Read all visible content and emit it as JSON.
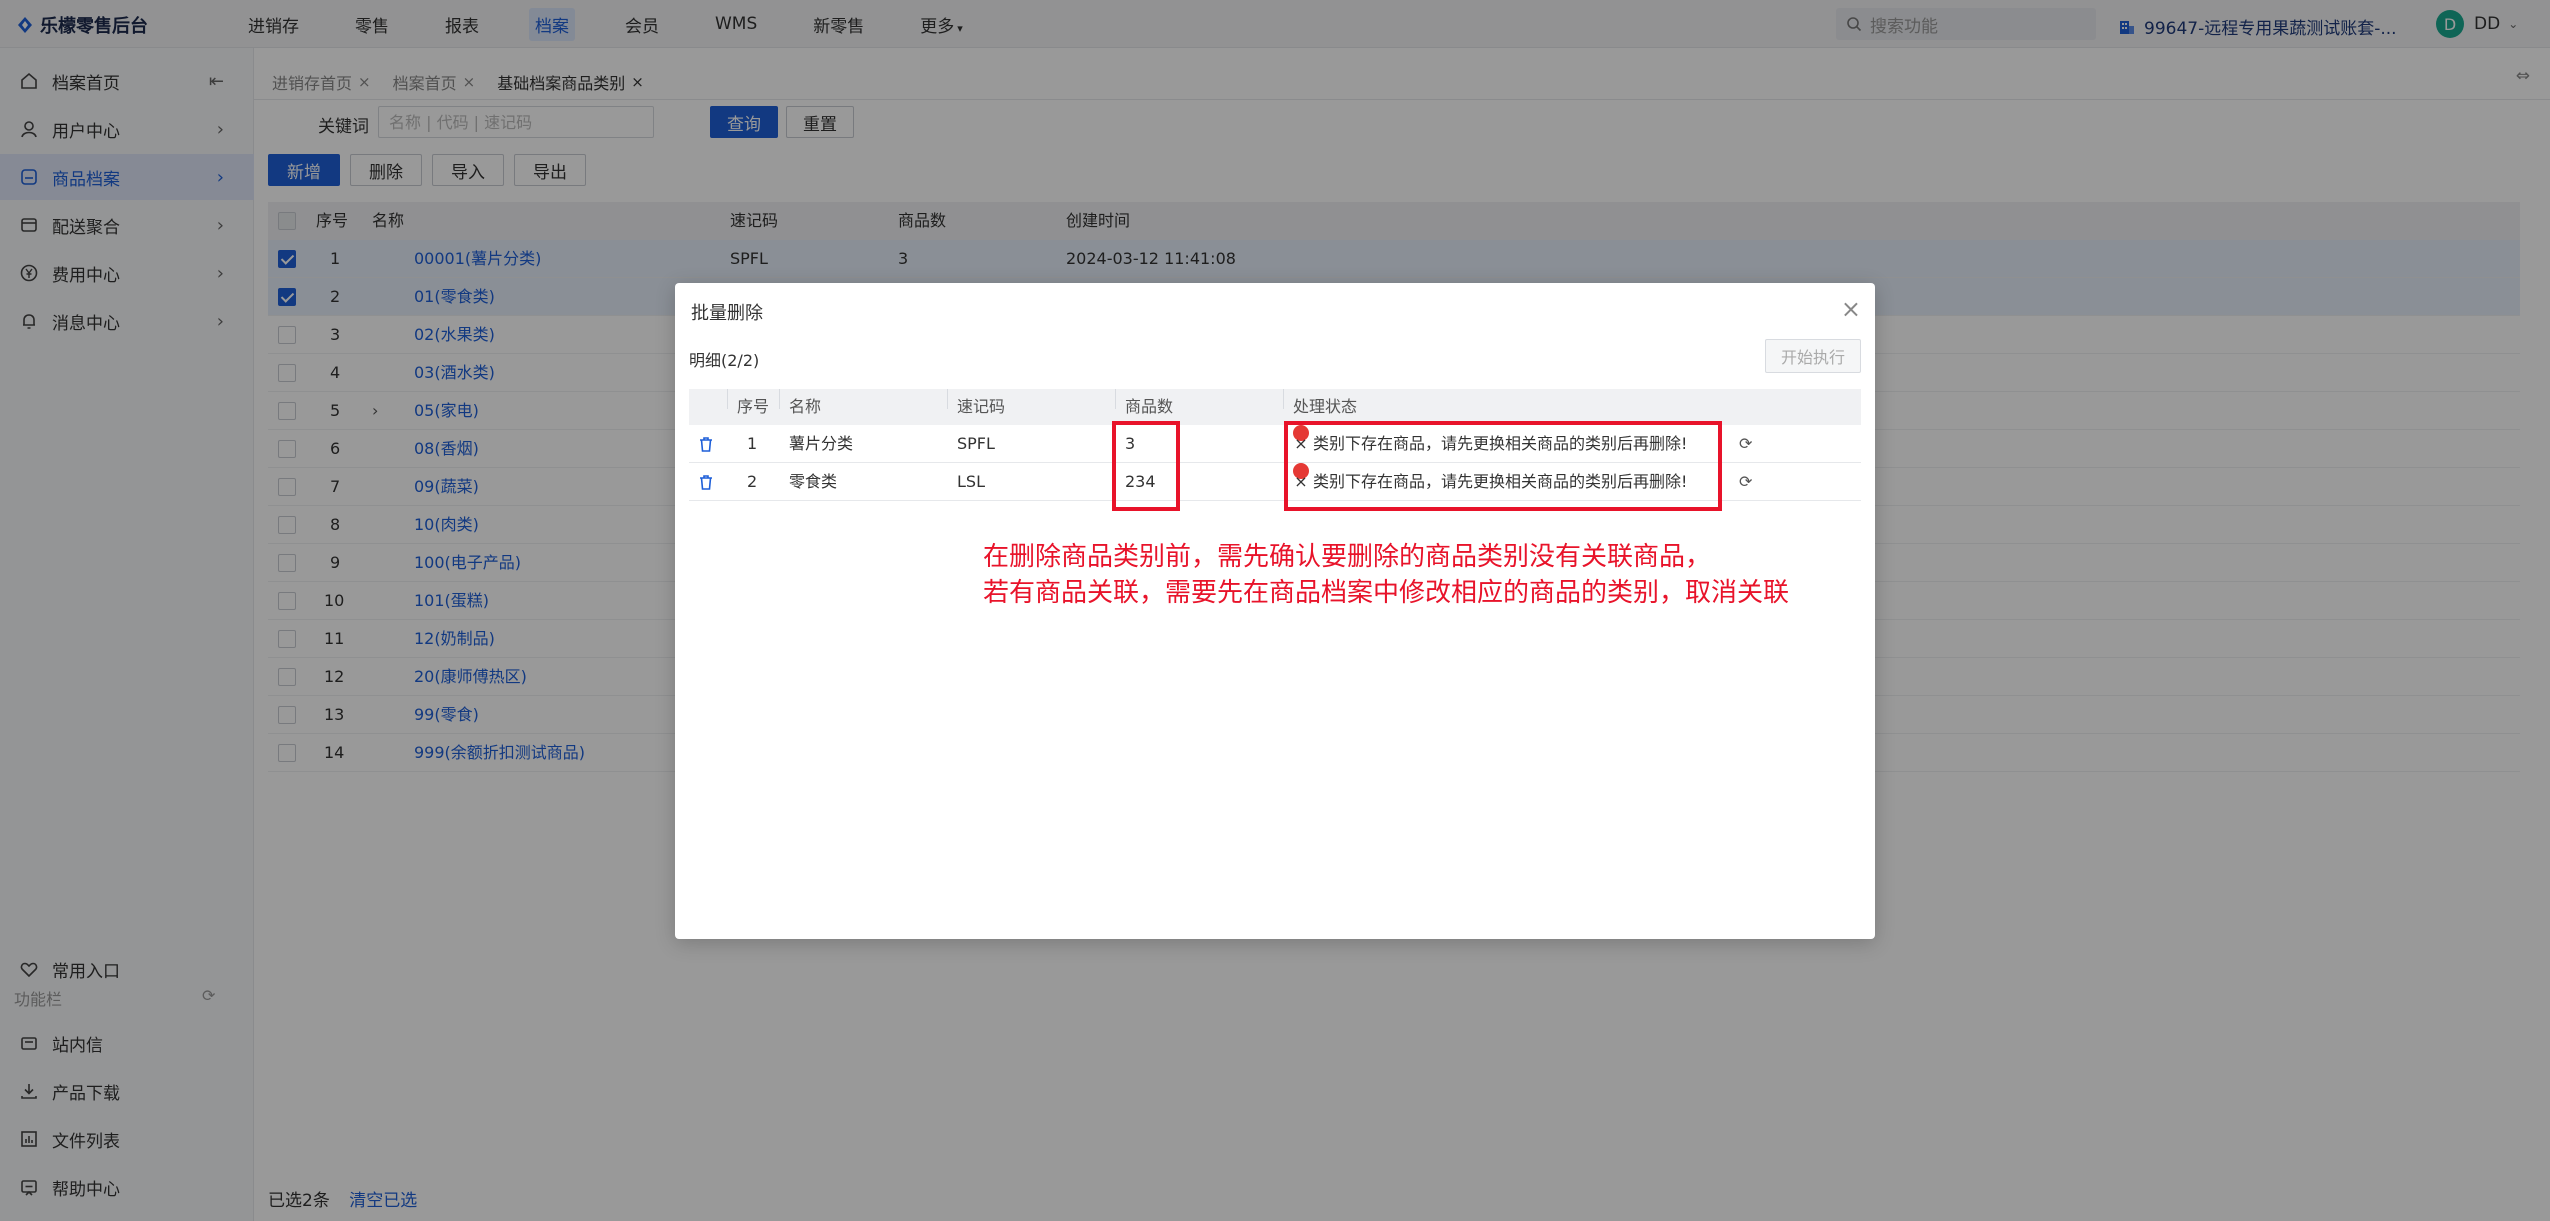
{
  "app": {
    "name": "乐檬零售后台"
  },
  "topnav": [
    "进销存",
    "零售",
    "报表",
    "档案",
    "会员",
    "WMS",
    "新零售",
    "更多"
  ],
  "topnav_active": "档案",
  "search": {
    "placeholder": "搜索功能"
  },
  "account": {
    "label": "99647-远程专用果蔬测试账套-..."
  },
  "user": {
    "initial": "D",
    "name": "DD"
  },
  "sidebar": {
    "items": [
      {
        "label": "档案首页",
        "icon": "home-icon"
      },
      {
        "label": "用户中心",
        "icon": "user-icon"
      },
      {
        "label": "商品档案",
        "icon": "box-icon"
      },
      {
        "label": "配送聚合",
        "icon": "delivery-icon"
      },
      {
        "label": "费用中心",
        "icon": "yen-icon"
      },
      {
        "label": "消息中心",
        "icon": "bell-icon"
      }
    ],
    "favorites": "常用入口",
    "section": "功能栏",
    "bottom": [
      {
        "label": "站内信",
        "icon": "mail-icon"
      },
      {
        "label": "产品下载",
        "icon": "download-icon"
      },
      {
        "label": "文件列表",
        "icon": "chart-icon"
      },
      {
        "label": "帮助中心",
        "icon": "help-icon"
      }
    ]
  },
  "tabs": [
    "进销存首页",
    "档案首页",
    "基础档案商品类别"
  ],
  "filter": {
    "label": "关键词",
    "placeholder": "名称 | 代码 | 速记码",
    "query": "查询",
    "reset": "重置"
  },
  "toolbar": {
    "add": "新增",
    "delete": "删除",
    "import": "导入",
    "export": "导出"
  },
  "table": {
    "columns": [
      "序号",
      "名称",
      "速记码",
      "商品数",
      "创建时间"
    ],
    "rows": [
      {
        "no": "1",
        "name": "00001(薯片分类)",
        "code": "SPFL",
        "count": "3",
        "time": "2024-03-12 11:41:08"
      },
      {
        "no": "2",
        "name": "01(零食类)",
        "code": "",
        "count": "",
        "time": ""
      },
      {
        "no": "3",
        "name": "02(水果类)"
      },
      {
        "no": "4",
        "name": "03(酒水类)"
      },
      {
        "no": "5",
        "name": "05(家电)"
      },
      {
        "no": "6",
        "name": "08(香烟)"
      },
      {
        "no": "7",
        "name": "09(蔬菜)"
      },
      {
        "no": "8",
        "name": "10(肉类)"
      },
      {
        "no": "9",
        "name": "100(电子产品)"
      },
      {
        "no": "10",
        "name": "101(蛋糕)"
      },
      {
        "no": "11",
        "name": "12(奶制品)"
      },
      {
        "no": "12",
        "name": "20(康师傅热区)"
      },
      {
        "no": "13",
        "name": "99(零食)"
      },
      {
        "no": "14",
        "name": "999(余额折扣测试商品)"
      }
    ]
  },
  "selection": {
    "text": "已选2条",
    "clear": "清空已选"
  },
  "dialog": {
    "title": "批量删除",
    "detail": "明细(2/2)",
    "run": "开始执行",
    "columns": [
      "序号",
      "名称",
      "速记码",
      "商品数",
      "处理状态"
    ],
    "rows": [
      {
        "no": "1",
        "name": "薯片分类",
        "code": "SPFL",
        "count": "3",
        "status": "类别下存在商品，请先更换相关商品的类别后再删除!"
      },
      {
        "no": "2",
        "name": "零食类",
        "code": "LSL",
        "count": "234",
        "status": "类别下存在商品，请先更换相关商品的类别后再删除!"
      }
    ],
    "annotation": [
      "在删除商品类别前，需先确认要删除的商品类别没有关联商品，",
      "若有商品关联，需要先在商品档案中修改相应的商品的类别，取消关联"
    ]
  }
}
